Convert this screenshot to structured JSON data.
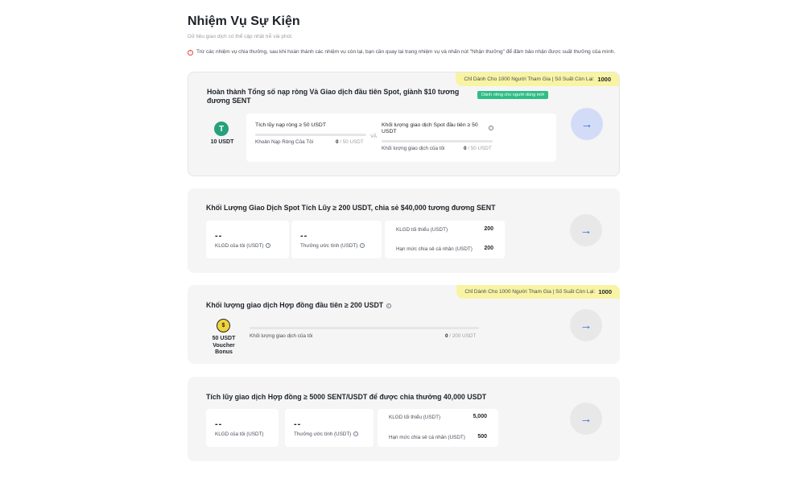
{
  "page": {
    "title": "Nhiệm Vụ Sự Kiện",
    "subtitle": "Dữ liệu giao dịch có thể cập nhật trễ vài phút.",
    "notice": "Trừ các nhiệm vụ chia thưởng, sau khi hoàn thành các nhiệm vụ còn lại, bạn cần quay lại trang nhiệm vụ và nhấn nút \"Nhận thưởng\" để đảm bảo nhận được suất thưởng của mình."
  },
  "colors": {
    "accent_green": "#2ebd85",
    "ribbon_yellow": "#f8f4a4",
    "arrow_blue": "#3b6fe0",
    "tether_green": "#26a17b"
  },
  "tasks": [
    {
      "ribbon_text": "Chỉ Dành Cho 1000 Người Tham Gia | Số Suất Còn Lại:",
      "ribbon_count": "1000",
      "title": "Hoàn thành Tổng số nạp ròng Và Giao dịch đầu tiên Spot, giành $10 tương đương SENT",
      "badge": "Dành riêng cho người dùng mới",
      "reward_icon": "tether-coin-icon",
      "reward_icon_glyph": "T",
      "reward_label": "10 USDT",
      "conjunction": "VÀ",
      "req1": {
        "title": "Tích lũy nạp ròng ≥ 50 USDT",
        "progress_label": "Khoản Nạp Ròng Của Tôi",
        "current": "0",
        "target": "/ 50 USDT"
      },
      "req2": {
        "title": "Khối lượng giao dịch Spot đầu tiên ≥ 50 USDT",
        "progress_label": "Khối lượng giao dịch của tôi",
        "current": "0",
        "target": "/ 50 USDT"
      },
      "action_icon": "arrow-right-icon"
    },
    {
      "title": "Khối Lượng Giao Dịch Spot Tích Lũy ≥ 200 USDT, chia sẻ $40,000 tương đương SENT",
      "my_volume_value": "--",
      "my_volume_label": "KLGD của tôi (USDT)",
      "est_reward_value": "--",
      "est_reward_label": "Thưởng ước tính (USDT)",
      "min_volume_label": "KLGD tối thiểu (USDT)",
      "min_volume_value": "200",
      "cap_label": "Hạn mức chia sẻ cá nhân (USDT)",
      "cap_value": "200",
      "action_icon": "arrow-right-icon"
    },
    {
      "ribbon_text": "Chỉ Dành Cho 1000 Người Tham Gia | Số Suất Còn Lại:",
      "ribbon_count": "1000",
      "title": "Khối lượng giao dịch Hợp đồng đầu tiên ≥ 200 USDT",
      "reward_icon": "voucher-coin-icon",
      "reward_icon_glyph": "$",
      "reward_label_lines": [
        "50 USDT",
        "Voucher",
        "Bonus"
      ],
      "progress_label": "Khối lượng giao dịch của tôi",
      "current": "0",
      "target": "/ 200 USDT",
      "action_icon": "arrow-right-icon"
    },
    {
      "title": "Tích lũy giao dịch Hợp đồng ≥ 5000 SENT/USDT để được chia thưởng 40,000 USDT",
      "my_volume_value": "--",
      "my_volume_label": "KLGD của tôi (USDT)",
      "est_reward_value": "--",
      "est_reward_label": "Thưởng ước tính (USDT)",
      "min_volume_label": "KLGD tối thiểu (USDT)",
      "min_volume_value": "5,000",
      "cap_label": "Hạn mức chia sẻ cá nhân (USDT)",
      "cap_value": "500",
      "action_icon": "arrow-right-icon"
    }
  ]
}
